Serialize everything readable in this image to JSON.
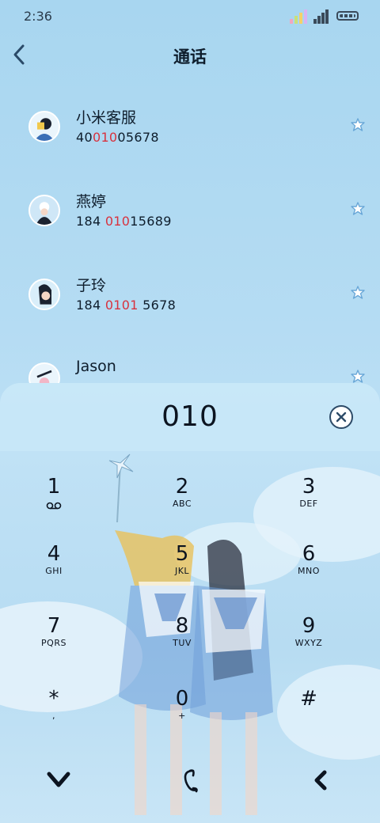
{
  "status_bar": {
    "time": "2:36"
  },
  "header": {
    "title": "通话"
  },
  "contacts": [
    {
      "name": "小米客服",
      "number_pre": "40",
      "number_hl": "010",
      "number_post": "05678"
    },
    {
      "name": "燕婷",
      "number_pre": "184 ",
      "number_hl": "010",
      "number_post": "15689"
    },
    {
      "name": "子玲",
      "number_pre": "184 ",
      "number_hl": "0101",
      "number_post": " 5678"
    },
    {
      "name": "Jason",
      "number_pre": "",
      "number_hl": "",
      "number_post": ""
    }
  ],
  "dialer": {
    "input": "010",
    "keys": [
      {
        "digit": "1",
        "letters": ""
      },
      {
        "digit": "2",
        "letters": "ABC"
      },
      {
        "digit": "3",
        "letters": "DEF"
      },
      {
        "digit": "4",
        "letters": "GHI"
      },
      {
        "digit": "5",
        "letters": "JKL"
      },
      {
        "digit": "6",
        "letters": "MNO"
      },
      {
        "digit": "7",
        "letters": "PQRS"
      },
      {
        "digit": "8",
        "letters": "TUV"
      },
      {
        "digit": "9",
        "letters": "WXYZ"
      },
      {
        "digit": "*",
        "letters": ","
      },
      {
        "digit": "0",
        "letters": "+"
      },
      {
        "digit": "#",
        "letters": ""
      }
    ]
  },
  "colors": {
    "highlight": "#d8323e",
    "accent": "#2d4b68"
  }
}
